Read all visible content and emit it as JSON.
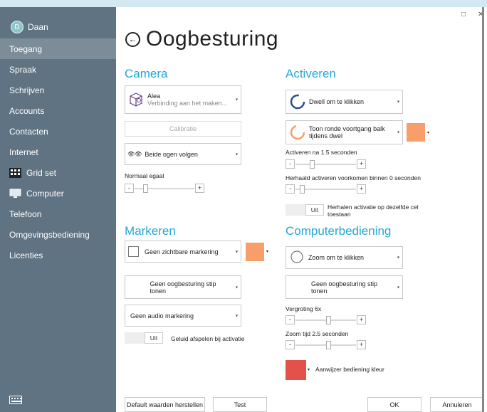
{
  "user": {
    "initial": "D",
    "name": "Daan"
  },
  "nav": [
    {
      "label": "Toegang",
      "active": true
    },
    {
      "label": "Spraak"
    },
    {
      "label": "Schrijven"
    },
    {
      "label": "Accounts"
    },
    {
      "label": "Contacten"
    },
    {
      "label": "Internet"
    },
    {
      "label": "Grid set",
      "icon": "grid-icon"
    },
    {
      "label": "Computer",
      "icon": "computer-icon"
    },
    {
      "label": "Telefoon"
    },
    {
      "label": "Omgevingsbediening"
    },
    {
      "label": "Licenties"
    }
  ],
  "window": {
    "maximize": "□",
    "close": "✕"
  },
  "page": {
    "back_icon": "back-arrow-icon",
    "title": "Oogbesturing"
  },
  "camera": {
    "heading": "Camera",
    "device_name": "Alea",
    "device_status": "Verbinding aan het maken...",
    "calibration": "Calibratie",
    "eyes_icon": "👁👁",
    "eyes": "Beide ogen volgen",
    "smoothing_label": "Normaal egaal",
    "smoothing_value": 0.15
  },
  "activate": {
    "heading": "Activeren",
    "dwell": "Dwell om te klikken",
    "progress_line1": "Toon ronde voortgang balk",
    "progress_line2": "tijdens dwel",
    "progress_color": "#f79e6a",
    "after_label": "Activeren na 1.5 seconden",
    "after_value": 0.25,
    "repeat_label": "Herhaald activeren voorkomen binnen 0 seconden",
    "repeat_value": 0.08,
    "repeat_toggle": "Uit",
    "repeat_text1": "Herhalen activatie op dezelfde cel",
    "repeat_text2": "toestaan"
  },
  "markers": {
    "heading": "Markeren",
    "visible_marking": "Geen zichtbare markering",
    "marking_color": "#f79e6a",
    "dot_line1": "Geen oogbesturing stip",
    "dot_line2": "tonen",
    "audio": "Geen audio markering",
    "sound_toggle": "Uit",
    "sound_text": "Geluid afspelen bij activatie"
  },
  "computer": {
    "heading": "Computerbediening",
    "zoom": "Zoom om te klikken",
    "dot_line1": "Geen oogbesturing stip",
    "dot_line2": "tonen",
    "magnify_label": "Vergroting 6x",
    "magnify_value": 0.55,
    "zoomtime_label": "Zoom tijd 2.5 seconden",
    "zoomtime_value": 0.55,
    "pointer_label": "Aanwijzer bediening kleur",
    "pointer_color": "#e2514a"
  },
  "footer": {
    "reset": "Default waarden herstellen",
    "test": "Test",
    "ok": "OK",
    "cancel": "Annuleren"
  }
}
